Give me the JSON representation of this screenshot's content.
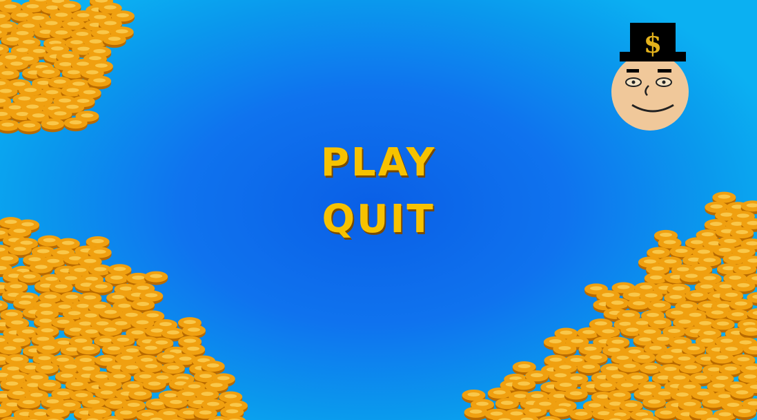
{
  "menu": {
    "play_label": "PLAY",
    "quit_label": "QUIT"
  },
  "mascot": {
    "hat_symbol": "$"
  },
  "colors": {
    "background_center": "#0a5fe6",
    "background_edge": "#0bb0f2",
    "menu_text": "#f7c200",
    "coin": "#f0a010",
    "coin_highlight": "#f9c74a",
    "coin_shadow": "#b86a00",
    "mascot_face": "#f0c89a",
    "hat": "#000000"
  },
  "icons": [
    "coin-pile-icon",
    "mascot-face-icon",
    "top-hat-icon",
    "dollar-sign-icon"
  ]
}
